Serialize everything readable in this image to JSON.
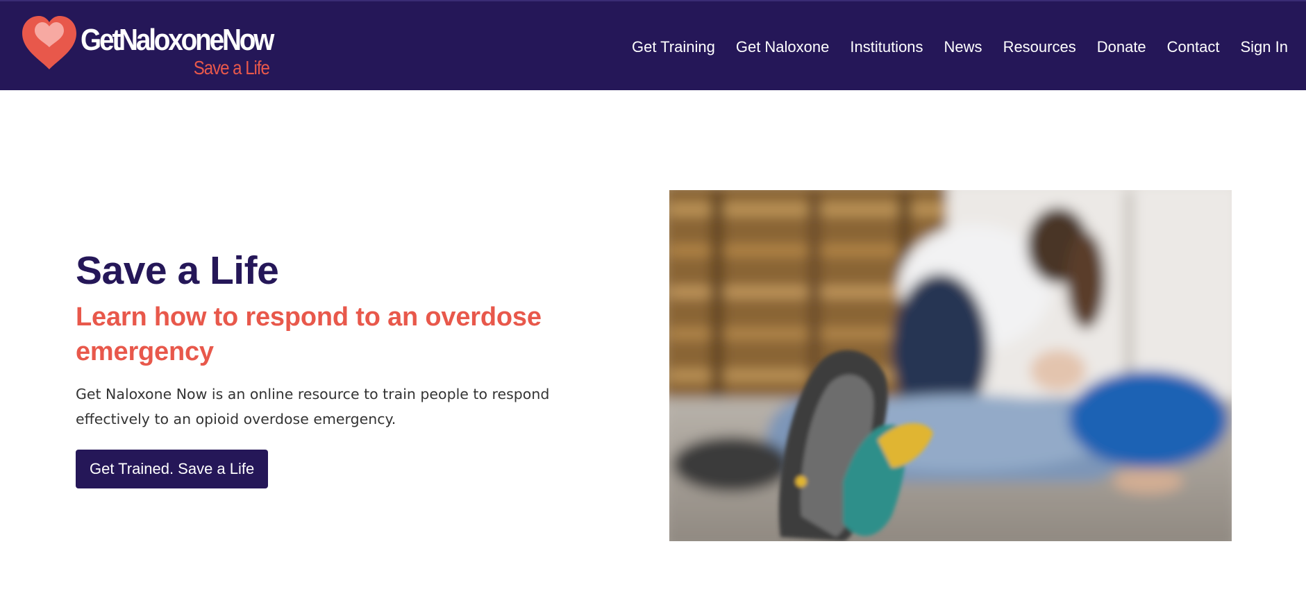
{
  "header": {
    "logo": {
      "name": "GetNaloxoneNow",
      "tagline": "Save a Life"
    },
    "nav": [
      {
        "label": "Get Training"
      },
      {
        "label": "Get Naloxone"
      },
      {
        "label": "Institutions"
      },
      {
        "label": "News"
      },
      {
        "label": "Resources"
      },
      {
        "label": "Donate"
      },
      {
        "label": "Contact"
      },
      {
        "label": "Sign In"
      }
    ]
  },
  "hero": {
    "title": "Save a Life",
    "subtitle": "Learn how to respond to an overdose emergency",
    "description": "Get Naloxone Now is an online resource to train people to respond effectively to an opioid overdose emergency.",
    "cta_label": "Get Trained. Save a Life"
  },
  "colors": {
    "brand_navy": "#251758",
    "brand_coral": "#e8584b",
    "text_body": "#333333",
    "background": "#ffffff"
  },
  "icons": {
    "logo_mark": "heart-icon"
  }
}
